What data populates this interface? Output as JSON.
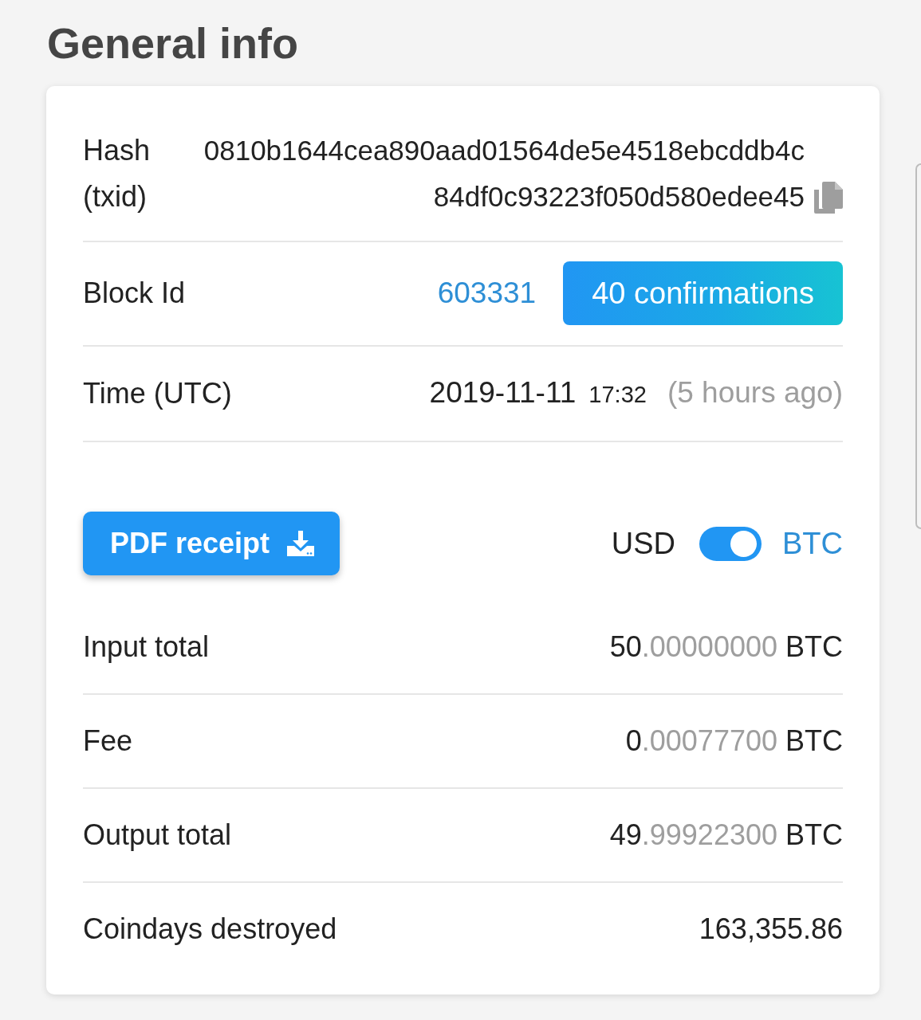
{
  "title": "General info",
  "hash": {
    "label": "Hash (txid)",
    "value": "0810b1644cea890aad01564de5e4518ebcddb4c84df0c93223f050d580edee45"
  },
  "block": {
    "label": "Block Id",
    "value": "603331",
    "confirmations": "40 confirmations"
  },
  "time": {
    "label": "Time (UTC)",
    "date": "2019-11-11",
    "clock": "17:32",
    "relative": "(5 hours ago)"
  },
  "actions": {
    "receipt_button": "PDF receipt",
    "currency_toggle": {
      "left": "USD",
      "right": "BTC",
      "on": true
    }
  },
  "totals": [
    {
      "kind": "amount",
      "label": "Input total",
      "whole": "50",
      "fraction": ".00000000",
      "unit": "BTC"
    },
    {
      "kind": "amount",
      "label": "Fee",
      "whole": "0",
      "fraction": ".00077700",
      "unit": "BTC"
    },
    {
      "kind": "amount",
      "label": "Output total",
      "whole": "49",
      "fraction": ".99922300",
      "unit": "BTC"
    },
    {
      "kind": "plain",
      "label": "Coindays destroyed",
      "value": "163,355.86"
    }
  ]
}
